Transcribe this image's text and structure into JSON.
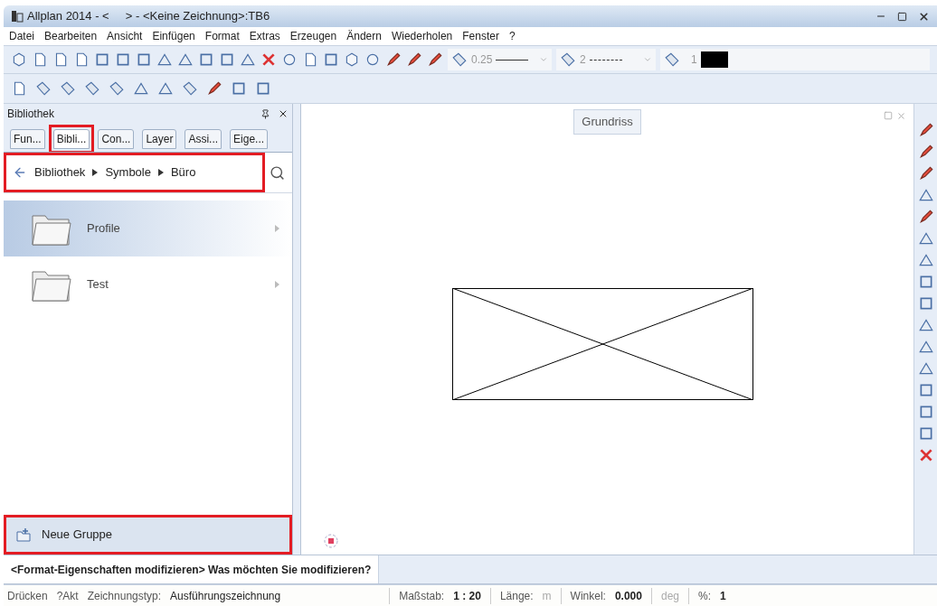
{
  "window": {
    "title": "Allplan 2014 - <     > - <Keine Zeichnung>:TB6"
  },
  "menu": [
    "Datei",
    "Bearbeiten",
    "Ansicht",
    "Einfügen",
    "Format",
    "Extras",
    "Erzeugen",
    "Ändern",
    "Wiederholen",
    "Fenster",
    "?"
  ],
  "toolbar": {
    "pen": "0.25",
    "line": "2",
    "pen_number": "1"
  },
  "panel": {
    "title": "Bibliothek",
    "tabs": [
      {
        "label": "Fun...",
        "selected": false,
        "highlighted": false
      },
      {
        "label": "Bibli...",
        "selected": true,
        "highlighted": true
      },
      {
        "label": "Con...",
        "selected": false,
        "highlighted": false
      },
      {
        "label": "Layer",
        "selected": false,
        "highlighted": false
      },
      {
        "label": "Assi...",
        "selected": false,
        "highlighted": false
      },
      {
        "label": "Eige...",
        "selected": false,
        "highlighted": false
      }
    ],
    "breadcrumb": {
      "highlighted": true,
      "items": [
        "Bibliothek",
        "Symbole",
        "Büro"
      ]
    },
    "folders": [
      {
        "name": "Profile",
        "selected": true
      },
      {
        "name": "Test",
        "selected": false
      }
    ],
    "new_group": {
      "label": "Neue Gruppe",
      "highlighted": true
    }
  },
  "viewport": {
    "title": "Grundriss"
  },
  "command_line": {
    "text": "<Format-Eigenschaften modifizieren> Was möchten Sie modifizieren?"
  },
  "status_bar": [
    [
      {
        "text": "Drücken",
        "kind": "label"
      },
      {
        "text": "?Akt",
        "kind": "label"
      },
      {
        "text": "Zeichnungstyp:",
        "kind": "label"
      },
      {
        "text": "Ausführungszeichnung",
        "kind": "value"
      }
    ],
    [
      {
        "text": "Maßstab:",
        "kind": "label"
      },
      {
        "text": "1 : 20",
        "kind": "bold"
      }
    ],
    [
      {
        "text": "Länge:",
        "kind": "label"
      },
      {
        "text": "m",
        "kind": "unit"
      }
    ],
    [
      {
        "text": "Winkel:",
        "kind": "label"
      },
      {
        "text": "0.000",
        "kind": "bold"
      }
    ],
    [
      {
        "text": "deg",
        "kind": "unit"
      }
    ],
    [
      {
        "text": "%:",
        "kind": "label"
      },
      {
        "text": "1",
        "kind": "bold"
      }
    ]
  ]
}
